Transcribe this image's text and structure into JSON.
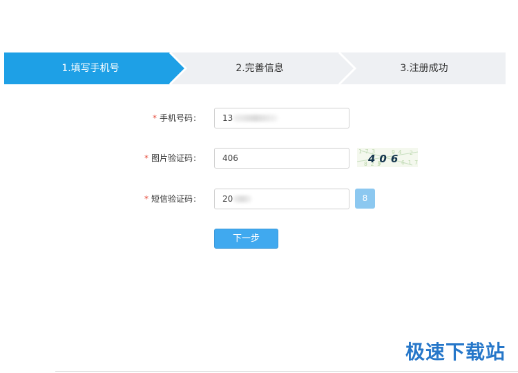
{
  "steps": {
    "step1_label": "1.填写手机号",
    "step2_label": "2.完善信息",
    "step3_label": "3.注册成功",
    "active_color": "#1ea0e6",
    "inactive_color": "#eef0f3"
  },
  "form": {
    "required_mark": "*",
    "phone": {
      "label": "手机号码",
      "colon": ":",
      "value": "13"
    },
    "captcha": {
      "label": "图片验证码",
      "colon": ":",
      "value": "406",
      "image_text": "406"
    },
    "sms": {
      "label": "短信验证码",
      "colon": ":",
      "value": "20",
      "button_label": "8"
    },
    "next_button_label": "下一步"
  },
  "watermark": {
    "text": "极速下载站",
    "color": "#2677c9"
  },
  "colors": {
    "primary_button": "#40a9ef",
    "sms_button": "#8cc8f0",
    "required_star": "#e64b3b"
  }
}
